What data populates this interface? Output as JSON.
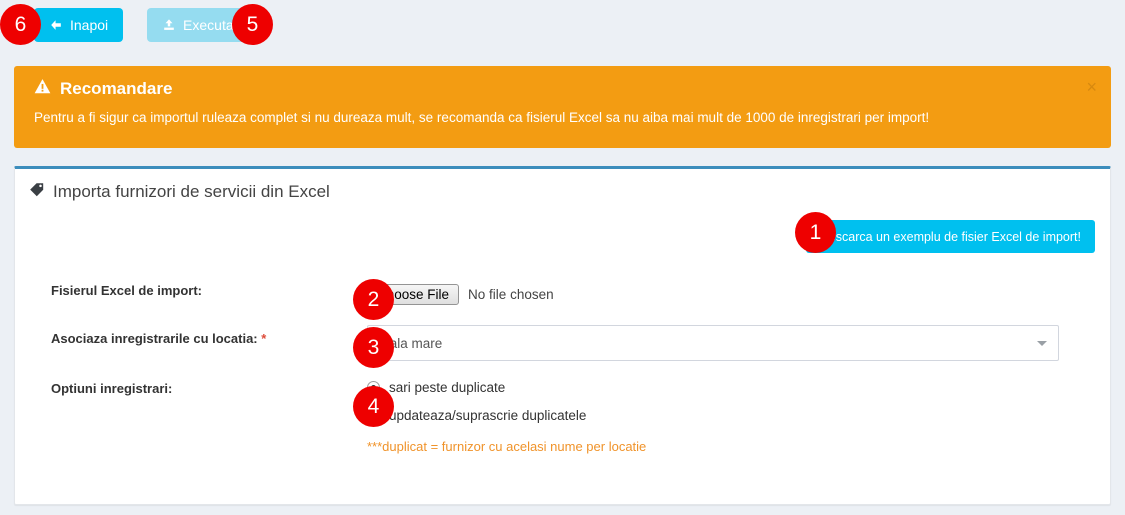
{
  "toolbar": {
    "back_label": "Inapoi",
    "back_icon": "arrow-left-icon",
    "execute_label": "Executa",
    "execute_icon": "upload-icon"
  },
  "callouts": [
    {
      "id": "1",
      "label": "1"
    },
    {
      "id": "2",
      "label": "2"
    },
    {
      "id": "3",
      "label": "3"
    },
    {
      "id": "4",
      "label": "4"
    },
    {
      "id": "5",
      "label": "5"
    },
    {
      "id": "6",
      "label": "6"
    }
  ],
  "alert": {
    "icon": "warning-triangle-icon",
    "title": "Recomandare",
    "message": "Pentru a fi sigur ca importul ruleaza complet si nu dureaza mult, se recomanda ca fisierul Excel sa nu aiba mai mult de 1000 de inregistrari per import!",
    "close_label": "×",
    "background_color": "#f39c12"
  },
  "panel": {
    "icon": "tag-icon",
    "title": "Importa furnizori de servicii din Excel",
    "accent_color": "#3c8dbc",
    "download_button_label": "Descarca un exemplu de fisier Excel de import!",
    "download_button_color": "#00c0ef"
  },
  "form": {
    "file_row": {
      "label": "Fisierul Excel de import:",
      "choose_button_label": "Choose File",
      "file_status": "No file chosen"
    },
    "location_row": {
      "label": "Asociaza inregistrarile cu locatia:",
      "required_mark": "*",
      "selected_value": "Hala mare"
    },
    "options_row": {
      "label": "Optiuni inregistrari:",
      "options": [
        {
          "label": "sari peste duplicate",
          "checked": true
        },
        {
          "label": "updateaza/suprascrie duplicatele",
          "checked": false
        }
      ],
      "note": "***duplicat = furnizor cu acelasi nume per locatie",
      "note_color": "#f0932a"
    }
  }
}
